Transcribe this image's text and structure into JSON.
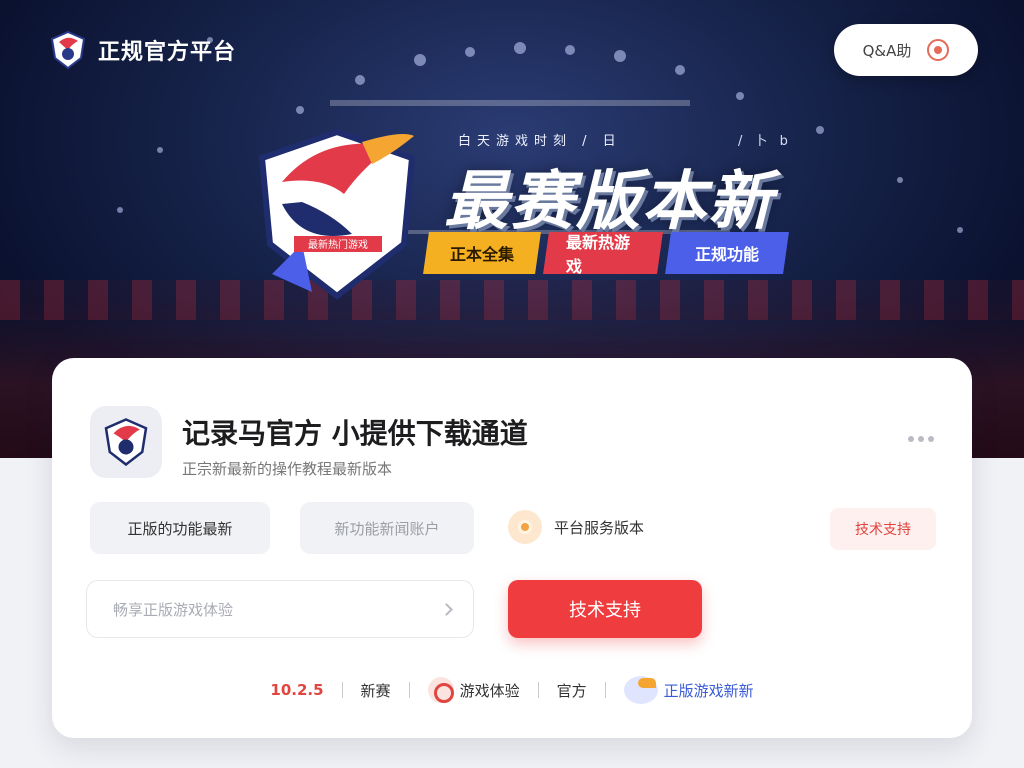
{
  "header": {
    "brand_name": "正规官方平台",
    "search_label": "Q&A助",
    "colors": {
      "accent_red": "#ef3c3f",
      "chip_yellow": "#f4b020",
      "chip_red": "#e23a48",
      "chip_blue": "#4b5fe8"
    }
  },
  "hero": {
    "tagline_left": "白天游戏时刻 / 日",
    "tagline_right": "/ 卜 b",
    "headline": "最赛版本新",
    "chips": [
      "正本全集",
      "最新热游戏",
      "正规功能"
    ],
    "emblem_badge": "最新热门游戏"
  },
  "card": {
    "app_title": "记录马官方 小提供下载通道",
    "app_subtitle": "正宗新最新的操作教程最新版本",
    "btn_update": "正版的功能最新",
    "btn_account": "新功能新闻账户",
    "feature_label": "平台服务版本",
    "support_label": "技术支持",
    "field_placeholder": "畅享正版游戏体验",
    "primary_label": "技术支持"
  },
  "footer": {
    "version": "10.2.5",
    "item_download": "新赛",
    "item_experience": "游戏体验",
    "item_official": "官方",
    "item_partner": "正版游戏新新"
  }
}
